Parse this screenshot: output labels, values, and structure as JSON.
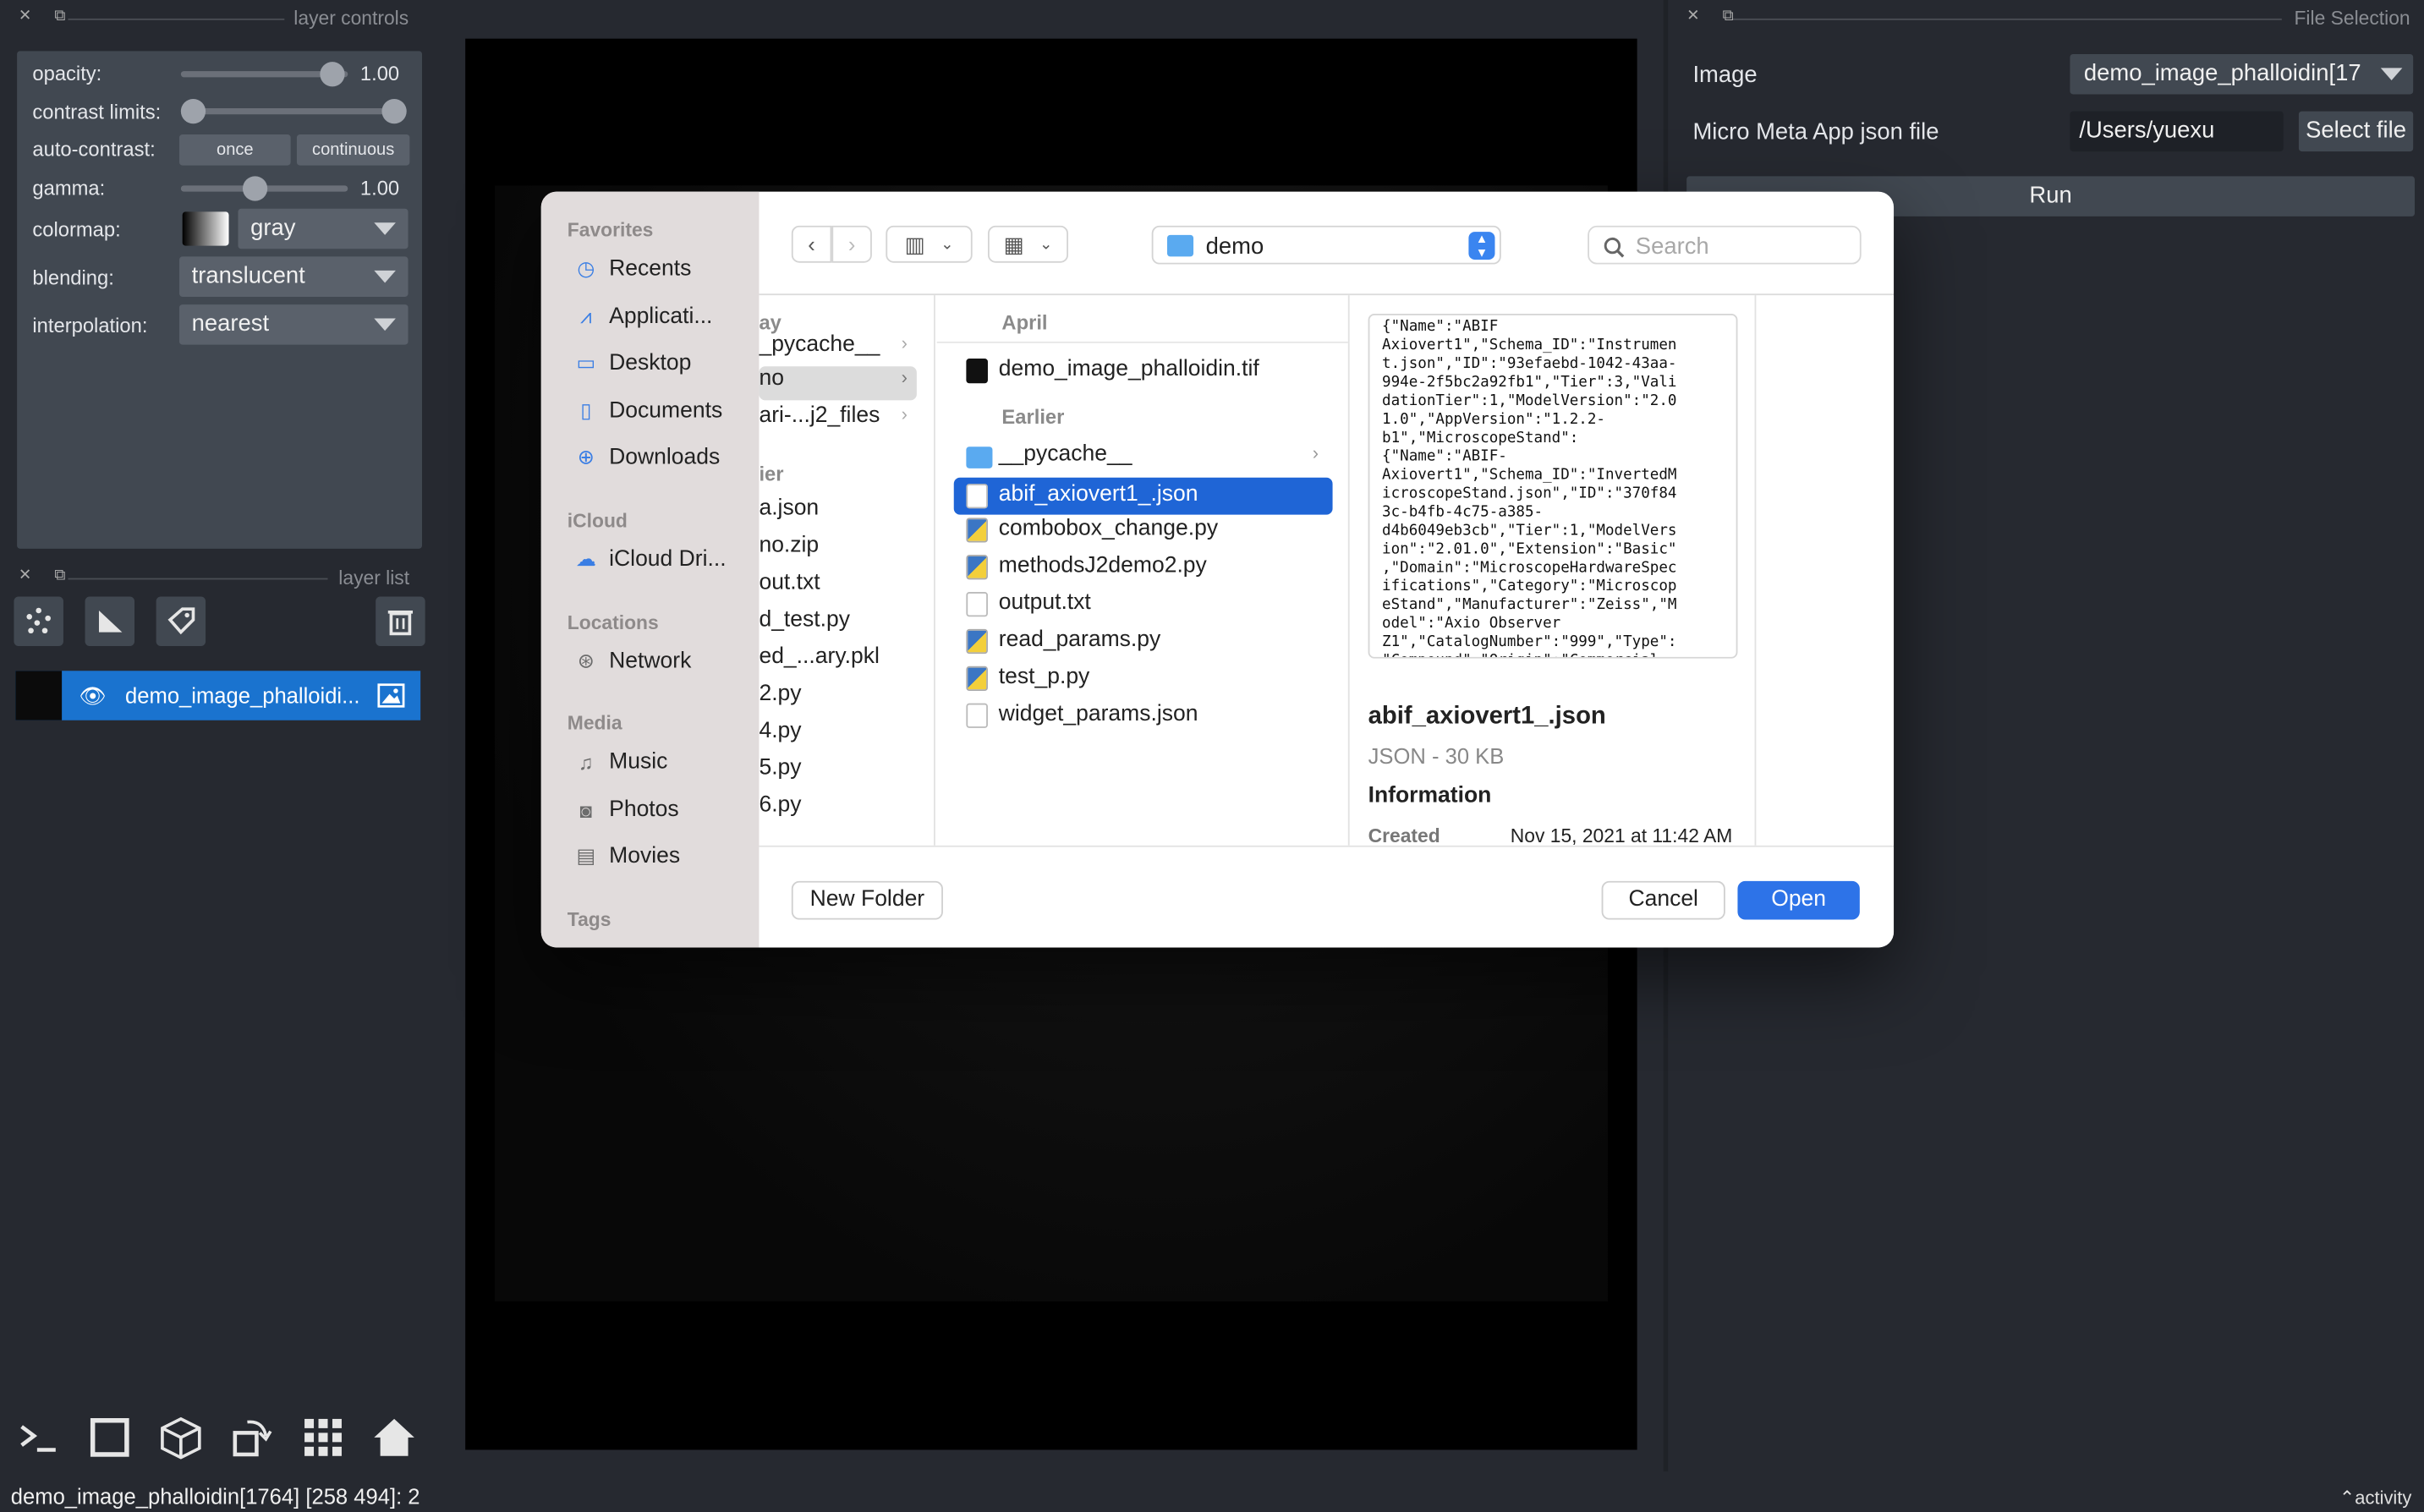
{
  "layer_controls": {
    "title": "layer controls",
    "opacity_label": "opacity:",
    "opacity_value": "1.00",
    "contrast_label": "contrast limits:",
    "autocontrast_label": "auto-contrast:",
    "once_label": "once",
    "continuous_label": "continuous",
    "gamma_label": "gamma:",
    "gamma_value": "1.00",
    "colormap_label": "colormap:",
    "colormap_value": "gray",
    "blending_label": "blending:",
    "blending_value": "translucent",
    "interpolation_label": "interpolation:",
    "interpolation_value": "nearest"
  },
  "layer_list": {
    "title": "layer list",
    "layer_name": "demo_image_phalloidi..."
  },
  "status": {
    "text": "demo_image_phalloidin[1764] [258 494]: 2",
    "activity": "activity"
  },
  "file_selection": {
    "title": "File Selection",
    "image_label": "Image",
    "image_value": "demo_image_phalloidin[17",
    "json_label": "Micro Meta App json file",
    "json_value": "/Users/yuexu",
    "select_file": "Select file",
    "run": "Run"
  },
  "dialog": {
    "sidebar": {
      "favorites_head": "Favorites",
      "favorites": [
        "Recents",
        "Applicati...",
        "Desktop",
        "Documents",
        "Downloads"
      ],
      "icloud_head": "iCloud",
      "icloud": [
        "iCloud Dri..."
      ],
      "locations_head": "Locations",
      "locations": [
        "Network"
      ],
      "media_head": "Media",
      "media": [
        "Music",
        "Photos",
        "Movies"
      ],
      "tags_head": "Tags"
    },
    "folder": "demo",
    "search_placeholder": "Search",
    "col1": {
      "sec_top": "ay",
      "items_top": [
        "_pycache__",
        "no",
        "ari-...j2_files"
      ],
      "sec_bottom": "ier",
      "items_bottom": [
        "a.json",
        "no.zip",
        "out.txt",
        "d_test.py",
        "ed_...ary.pkl",
        "2.py",
        "4.py",
        "5.py",
        "6.py"
      ]
    },
    "col2": {
      "april": "April",
      "april_items": [
        "demo_image_phalloidin.tif"
      ],
      "earlier": "Earlier",
      "earlier_items": [
        "__pycache__",
        "abif_axiovert1_.json",
        "combobox_change.py",
        "methodsJ2demo2.py",
        "output.txt",
        "read_params.py",
        "test_p.py",
        "widget_params.json"
      ]
    },
    "preview_text": "{\"Name\":\"ABIF\nAxiovert1\",\"Schema_ID\":\"Instrumen\nt.json\",\"ID\":\"93efaebd-1042-43aa-\n994e-2f5bc2a92fb1\",\"Tier\":3,\"Vali\ndationTier\":1,\"ModelVersion\":\"2.0\n1.0\",\"AppVersion\":\"1.2.2-\nb1\",\"MicroscopeStand\":\n{\"Name\":\"ABIF-\nAxiovert1\",\"Schema_ID\":\"InvertedM\nicroscopeStand.json\",\"ID\":\"370f84\n3c-b4fb-4c75-a385-\nd4b6049eb3cb\",\"Tier\":1,\"ModelVers\nion\":\"2.01.0\",\"Extension\":\"Basic\"\n,\"Domain\":\"MicroscopeHardwareSpec\nifications\",\"Category\":\"Microscop\neStand\",\"Manufacturer\":\"Zeiss\",\"M\nodel\":\"Axio Observer\nZ1\",\"CatalogNumber\":\"999\",\"Type\":\n\"Compound\",\"Origin\":\"Commercial-",
    "info_title": "abif_axiovert1_.json",
    "info_sub": "JSON - 30 KB",
    "info_head": "Information",
    "created_label": "Created",
    "created_value": "Nov 15, 2021 at 11:42 AM",
    "new_folder": "New Folder",
    "cancel": "Cancel",
    "open": "Open"
  }
}
